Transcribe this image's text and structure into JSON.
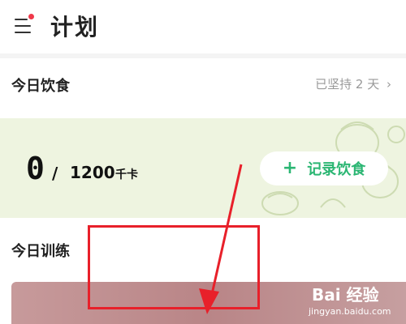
{
  "header": {
    "title": "计划",
    "menu_icon": "hamburger-icon"
  },
  "diet": {
    "section_title": "今日饮食",
    "streak": "已坚持 2 天",
    "chevron": "›",
    "calories": {
      "current": "0",
      "separator": "/",
      "target": "1200",
      "unit": "千卡"
    },
    "record_button": {
      "plus": "+",
      "label": "记录饮食"
    }
  },
  "training": {
    "section_title": "今日训练"
  },
  "annotation": {
    "color": "#e8202a"
  },
  "watermark": {
    "logo": "Bai 经验",
    "subtext": "jingyan.baidu.com"
  },
  "colors": {
    "accent": "#2bb673",
    "card_bg": "#eef4e0",
    "notify_dot": "#f0394a"
  }
}
